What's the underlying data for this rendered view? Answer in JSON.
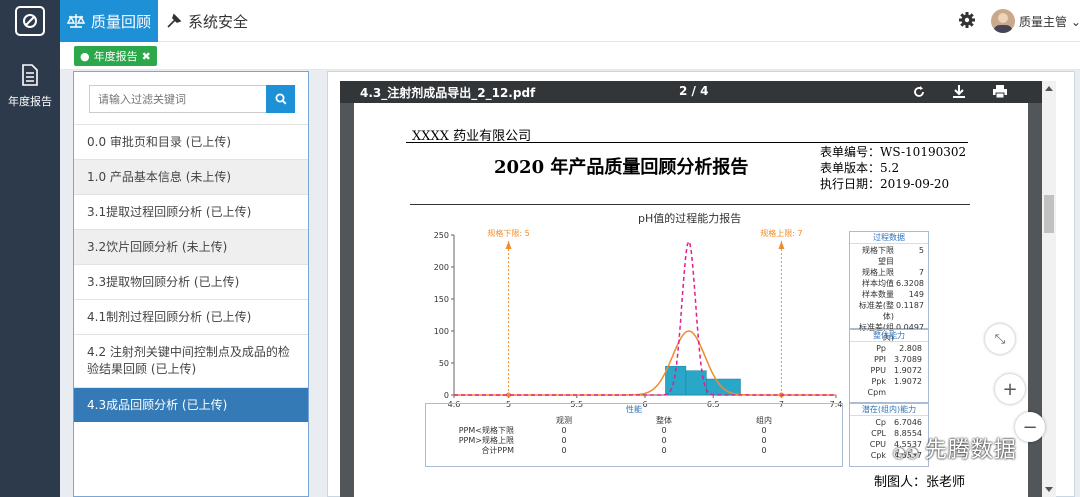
{
  "topbar": {
    "nav_quality": "质量回顾",
    "nav_security": "系统安全",
    "user_name": "质量主管"
  },
  "tabs": {
    "annual_report": "年度报告"
  },
  "sidebar": {
    "annual_report_label": "年度报告"
  },
  "search": {
    "placeholder": "请输入过滤关键词"
  },
  "list": {
    "items": [
      {
        "label": "0.0 审批页和目录 (已上传)"
      },
      {
        "label": "1.0 产品基本信息 (未上传)"
      },
      {
        "label": "3.1提取过程回顾分析 (已上传)"
      },
      {
        "label": "3.2饮片回顾分析 (未上传)"
      },
      {
        "label": "3.3提取物回顾分析 (已上传)"
      },
      {
        "label": "4.1制剂过程回顾分析 (已上传)"
      },
      {
        "label": "4.2 注射剂关键中间控制点及成品的检验结果回顾 (已上传)"
      },
      {
        "label": "4.3成品回顾分析 (已上传)"
      }
    ]
  },
  "viewer": {
    "filename": "4.3_注射剂成品导出_2_12.pdf",
    "page_indicator": "2 / 4"
  },
  "document": {
    "company": "XXXX 药业有限公司",
    "title": "2020 年产品质量回顾分析报告",
    "form_no": "表单编号：WS-10190302",
    "form_version": "表单版本：5.2",
    "exec_date": "执行日期：2019-09-20",
    "chart_title": "pH值的过程能力报告",
    "lsl_label": "规格下限: 5",
    "usl_label": "规格上限: 7",
    "process_data": {
      "header": "过程数据",
      "rows": [
        [
          "规格下限",
          "5"
        ],
        [
          "望目",
          ""
        ],
        [
          "规格上限",
          "7"
        ],
        [
          "样本均值",
          "6.3208"
        ],
        [
          "样本数量",
          "149"
        ],
        [
          "标准差(整体)",
          "0.1187"
        ],
        [
          "标准差(组内)",
          "0.0497"
        ]
      ]
    },
    "overall": {
      "header": "整体能力",
      "rows": [
        [
          "Pp",
          "2.808"
        ],
        [
          "PPI",
          "3.7089"
        ],
        [
          "PPU",
          "1.9072"
        ],
        [
          "Ppk",
          "1.9072"
        ],
        [
          "Cpm",
          ""
        ]
      ]
    },
    "potential": {
      "header": "潜在(组内)能力",
      "rows": [
        [
          "Cp",
          "6.7046"
        ],
        [
          "CPL",
          "8.8554"
        ],
        [
          "CPU",
          "4.5537"
        ],
        [
          "Cpk",
          "4.5537"
        ]
      ]
    },
    "performance": {
      "header": "性能",
      "cols": [
        "观测",
        "整体",
        "组内"
      ],
      "rows": [
        [
          "PPM<规格下限",
          "0",
          "0",
          "0"
        ],
        [
          "PPM>规格上限",
          "0",
          "0",
          "0"
        ],
        [
          "合计PPM",
          "0",
          "0",
          "0"
        ]
      ]
    },
    "maker": "制图人：张老师"
  },
  "watermark": "先腾数据",
  "chart_data": {
    "type": "bar",
    "title": "pH值的过程能力报告",
    "xlim": [
      4.6,
      7.4
    ],
    "ylim": [
      0,
      250
    ],
    "x_ticks": [
      "4.6",
      "5",
      "5.5",
      "6",
      "6.5",
      "7",
      "7.4"
    ],
    "y_ticks": [
      "0",
      "50",
      "100",
      "150",
      "200",
      "250"
    ],
    "bins": [
      {
        "x0": 6.15,
        "x1": 6.3,
        "value": 45
      },
      {
        "x0": 6.3,
        "x1": 6.45,
        "value": 38
      },
      {
        "x0": 6.45,
        "x1": 6.7,
        "value": 25
      }
    ],
    "overall_curve": {
      "mean": 6.3208,
      "sd": 0.1187,
      "peak": 100,
      "color": "#f08c2c"
    },
    "within_curve": {
      "mean": 6.3208,
      "sd": 0.0497,
      "peak": 240,
      "color": "#e0208c"
    },
    "lsl": 5,
    "usl": 7,
    "bar_color": "#29a7c9"
  }
}
